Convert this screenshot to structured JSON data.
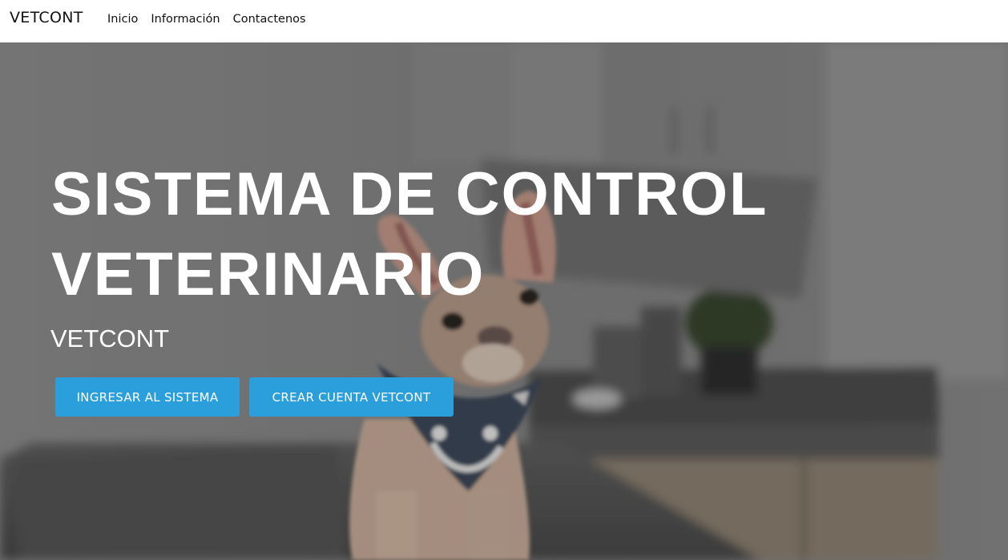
{
  "navbar": {
    "brand": "VETCONT",
    "links": [
      {
        "label": "Inicio"
      },
      {
        "label": "Información"
      },
      {
        "label": "Contactenos"
      }
    ]
  },
  "hero": {
    "title_line1": "SISTEMA DE CONTROL",
    "title_line2": "VETERINARIO",
    "subtitle": "VETCONT",
    "buttons": {
      "login_label": "INGRESAR AL SISTEMA",
      "signup_label": "CREAR CUENTA VETCONT"
    }
  },
  "colors": {
    "button_bg": "#2a9fdb",
    "hero_text": "#ffffff",
    "navbar_bg": "#ffffff"
  },
  "images": {
    "background": "french-bulldog-on-veterinary-exam-table-photo"
  }
}
